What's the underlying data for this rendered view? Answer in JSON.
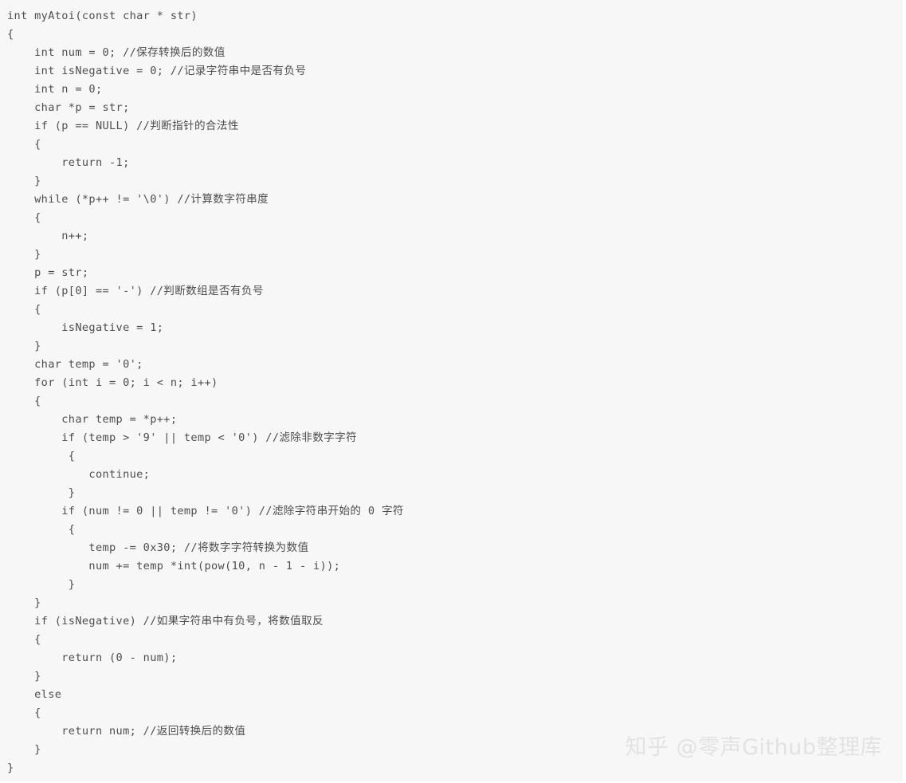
{
  "snippet": {
    "language": "c",
    "background_color": "#f7f7f7",
    "text_color": "#4e4e4e",
    "lines": [
      "int myAtoi(const char * str)",
      "{",
      "    int num = 0; //保存转换后的数值",
      "    int isNegative = 0; //记录字符串中是否有负号",
      "    int n = 0;",
      "    char *p = str;",
      "    if (p == NULL) //判断指针的合法性",
      "    {",
      "        return -1;",
      "    }",
      "    while (*p++ != '\\0') //计算数字符串度",
      "    {",
      "        n++;",
      "    }",
      "    p = str;",
      "    if (p[0] == '-') //判断数组是否有负号",
      "    {",
      "        isNegative = 1;",
      "    }",
      "    char temp = '0';",
      "    for (int i = 0; i < n; i++)",
      "    {",
      "        char temp = *p++;",
      "        if (temp > '9' || temp < '0') //滤除非数字字符",
      "         {",
      "            continue;",
      "         }",
      "        if (num != 0 || temp != '0') //滤除字符串开始的 0 字符",
      "         {",
      "            temp -= 0x30; //将数字字符转换为数值",
      "            num += temp *int(pow(10, n - 1 - i));",
      "         }",
      "    }",
      "    if (isNegative) //如果字符串中有负号，将数值取反",
      "    {",
      "        return (0 - num);",
      "    }",
      "    else",
      "    {",
      "        return num; //返回转换后的数值",
      "    }",
      "}"
    ]
  },
  "watermark": {
    "text": "知乎 @零声Github整理库",
    "color": "#e2e2e2"
  }
}
